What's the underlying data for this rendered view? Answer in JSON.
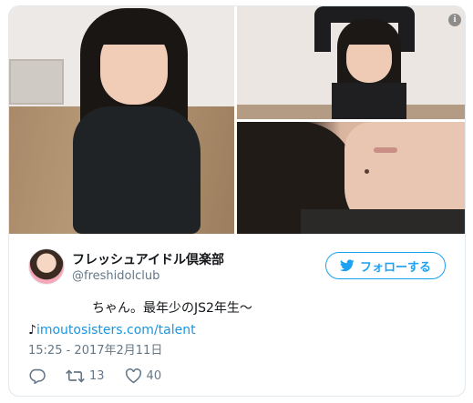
{
  "media": {
    "photos": [
      {
        "name": "photo-main",
        "alt": ""
      },
      {
        "name": "photo-top-right",
        "alt": ""
      },
      {
        "name": "photo-bottom-right",
        "alt": ""
      }
    ],
    "info_icon": "info-icon",
    "info_glyph": "i"
  },
  "author": {
    "display_name": "フレッシュアイドル倶楽部",
    "handle": "@freshidolclub",
    "avatar_icon": "avatar"
  },
  "follow_button": {
    "label": "フォローする",
    "icon": "twitter-bird-icon"
  },
  "tweet": {
    "line1": "ちゃん。最年少のJS2年生〜",
    "note_glyph": "♪",
    "link_text": "imoutosisters.com/talent"
  },
  "timestamp": "15:25 - 2017年2月11日",
  "actions": {
    "reply": {
      "icon": "reply-icon",
      "count": ""
    },
    "retweet": {
      "icon": "retweet-icon",
      "count": "13"
    },
    "like": {
      "icon": "heart-icon",
      "count": "40"
    }
  },
  "colors": {
    "accent": "#1da1f2",
    "link": "#1b95e0",
    "muted": "#657786",
    "border": "#e1e8ed"
  }
}
